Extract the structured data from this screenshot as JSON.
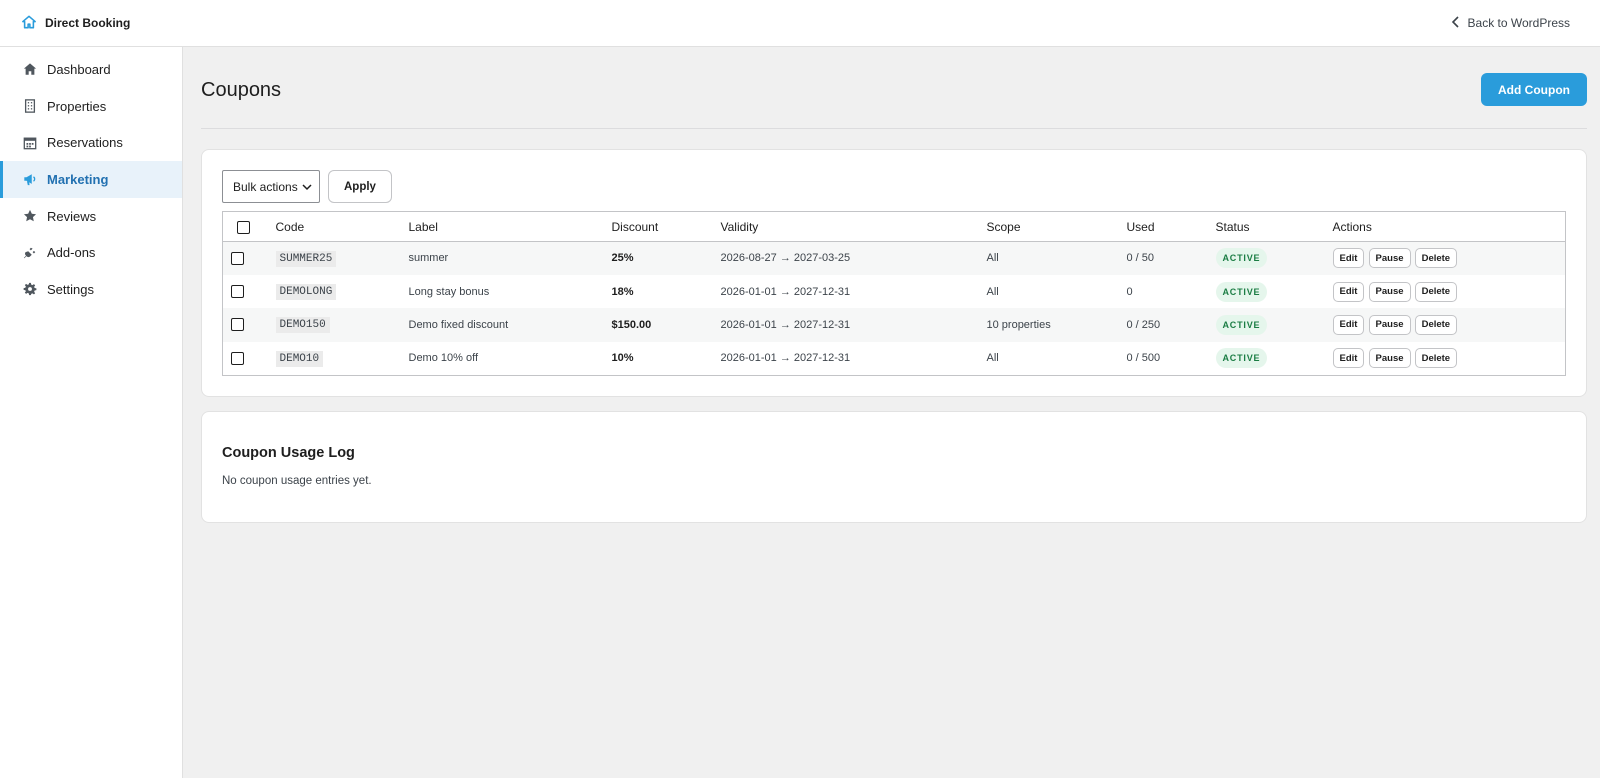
{
  "topbar": {
    "brand": "Direct Booking",
    "back_link": "Back to WordPress"
  },
  "sidebar": {
    "items": [
      {
        "label": "Dashboard",
        "icon": "home-icon"
      },
      {
        "label": "Properties",
        "icon": "building-icon"
      },
      {
        "label": "Reservations",
        "icon": "calendar-icon"
      },
      {
        "label": "Marketing",
        "icon": "megaphone-icon",
        "active": true
      },
      {
        "label": "Reviews",
        "icon": "star-icon"
      },
      {
        "label": "Add-ons",
        "icon": "plug-icon"
      },
      {
        "label": "Settings",
        "icon": "gear-icon"
      }
    ]
  },
  "page": {
    "title": "Coupons",
    "add_button": "Add Coupon"
  },
  "toolbar": {
    "bulk_actions": "Bulk actions",
    "apply": "Apply"
  },
  "table": {
    "headers": [
      "Code",
      "Label",
      "Discount",
      "Validity",
      "Scope",
      "Used",
      "Status",
      "Actions"
    ],
    "rows": [
      {
        "code": "SUMMER25",
        "label": "summer",
        "discount": "25%",
        "validity": "2026-08-27 → 2027-03-25",
        "scope": "All",
        "used": "0 / 50",
        "status": "ACTIVE"
      },
      {
        "code": "DEMOLONG",
        "label": "Long stay bonus",
        "discount": "18%",
        "validity": "2026-01-01 → 2027-12-31",
        "scope": "All",
        "used": "0",
        "status": "ACTIVE"
      },
      {
        "code": "DEMO150",
        "label": "Demo fixed discount",
        "discount": "$150.00",
        "validity": "2026-01-01 → 2027-12-31",
        "scope": "10 properties",
        "used": "0 / 250",
        "status": "ACTIVE"
      },
      {
        "code": "DEMO10",
        "label": "Demo 10% off",
        "discount": "10%",
        "validity": "2026-01-01 → 2027-12-31",
        "scope": "All",
        "used": "0 / 500",
        "status": "ACTIVE"
      }
    ],
    "actions": {
      "edit": "Edit",
      "pause": "Pause",
      "delete": "Delete"
    }
  },
  "usage_log": {
    "title": "Coupon Usage Log",
    "empty": "No coupon usage entries yet."
  },
  "colors": {
    "accent": "#2a9cdb",
    "active_nav_bg": "#e8f2fa",
    "badge_bg": "#e5f6ec",
    "badge_text": "#1b7d44"
  }
}
